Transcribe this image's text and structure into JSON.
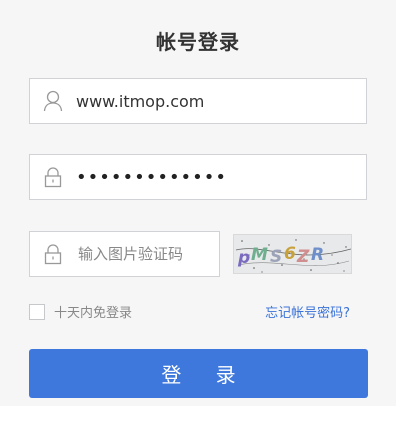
{
  "title": "帐号登录",
  "username": {
    "value": "www.itmop.com",
    "icon": "user-icon"
  },
  "password": {
    "masked_value": "•••••••••••••",
    "icon": "lock-icon"
  },
  "captcha": {
    "placeholder": "输入图片验证码",
    "icon": "lock-icon",
    "image_text": "pMS6ZR"
  },
  "remember_label": "十天内免登录",
  "forgot_link": "忘记帐号密码?",
  "login_button": "登 录",
  "colors": {
    "accent": "#3f78dd",
    "link": "#3b73d8"
  }
}
